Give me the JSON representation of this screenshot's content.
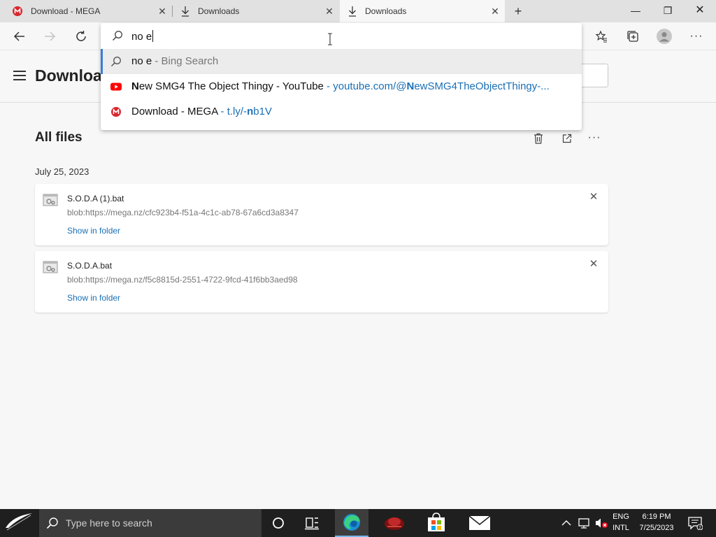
{
  "tabs": [
    {
      "title": "Download - MEGA",
      "icon": "mega-icon"
    },
    {
      "title": "Downloads",
      "icon": "download-icon"
    },
    {
      "title": "Downloads",
      "icon": "download-icon",
      "active": true
    }
  ],
  "address": {
    "query": "no e",
    "suggestions": [
      {
        "text": "no e",
        "sub": " - Bing Search",
        "icon": "search-icon"
      },
      {
        "bold": "N",
        "text": "ew SMG4 The Object Thingy - YouTube",
        "url_pre": " - youtube.com/@",
        "url_bold": "N",
        "url_post": "ewSMG4TheObjectThingy-...",
        "icon": "youtube-icon"
      },
      {
        "text": "Download - MEGA",
        "url_pre": " - t.ly/-",
        "url_bold": "n",
        "url_post": "b1V",
        "icon": "mega-icon"
      }
    ]
  },
  "page": {
    "title": "Downloads",
    "section_title": "All files",
    "date_label": "July 25, 2023"
  },
  "downloads": [
    {
      "name": "S.O.D.A (1).bat",
      "url": "blob:https://mega.nz/cfc923b4-f51a-4c1c-ab78-67a6cd3a8347",
      "action": "Show in folder"
    },
    {
      "name": "S.O.D.A.bat",
      "url": "blob:https://mega.nz/f5c8815d-2551-4722-9fcd-41f6bb3aed98",
      "action": "Show in folder"
    }
  ],
  "taskbar": {
    "search_placeholder": "Type here to search",
    "lang": "ENG",
    "layout": "INTL",
    "time": "6:19 PM",
    "date": "7/25/2023"
  },
  "colors": {
    "accent": "#3b7bd8",
    "link": "#1a6fb5",
    "mega_red": "#d9272e",
    "youtube_red": "#ff0000",
    "taskbar": "#1f1f1f"
  }
}
